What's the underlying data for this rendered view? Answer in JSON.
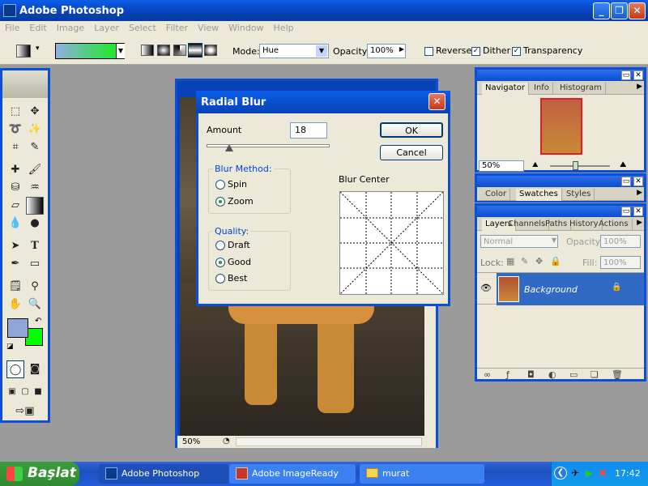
{
  "app": {
    "title": "Adobe Photoshop"
  },
  "menu": [
    "File",
    "Edit",
    "Image",
    "Layer",
    "Select",
    "Filter",
    "View",
    "Window",
    "Help"
  ],
  "options": {
    "mode_label": "Mode:",
    "mode_value": "Hue",
    "opacity_label": "Opacity:",
    "opacity_value": "100%",
    "reverse_label": "Reverse",
    "dither_label": "Dither",
    "transparency_label": "Transparency"
  },
  "image_window": {
    "zoom": "50%"
  },
  "dialog": {
    "title": "Radial Blur",
    "amount_label": "Amount",
    "amount_value": "18",
    "ok_label": "OK",
    "cancel_label": "Cancel",
    "method_label": "Blur Method:",
    "method_options": [
      "Spin",
      "Zoom"
    ],
    "quality_label": "Quality:",
    "quality_options": [
      "Draft",
      "Good",
      "Best"
    ],
    "center_label": "Blur Center"
  },
  "navigator_panel": {
    "tabs": [
      "Navigator",
      "Info",
      "Histogram"
    ],
    "zoom": "50%"
  },
  "color_panel": {
    "tabs": [
      "Color",
      "Swatches",
      "Styles"
    ]
  },
  "layers_panel": {
    "tabs": [
      "Layers",
      "Channels",
      "Paths",
      "History",
      "Actions"
    ],
    "blend_mode": "Normal",
    "opacity_label": "Opacity:",
    "opacity_value": "100%",
    "lock_label": "Lock:",
    "fill_label": "Fill:",
    "fill_value": "100%",
    "layer_name": "Background"
  },
  "taskbar": {
    "start_label": "Başlat",
    "tasks": [
      "Adobe Photoshop",
      "Adobe ImageReady",
      "murat"
    ],
    "clock": "17:42"
  },
  "colors": {
    "foreground": "#8fa6d6",
    "background": "#00ff00",
    "accent": "#0a4fd6"
  }
}
